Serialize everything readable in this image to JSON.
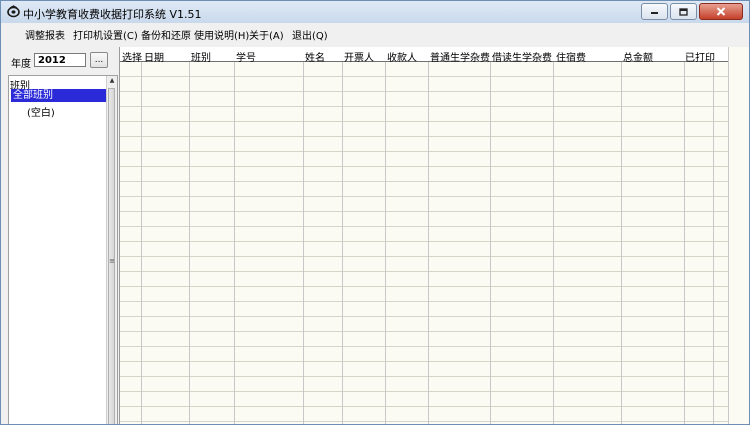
{
  "window": {
    "title": "中小学教育收费收据打印系统 V1.51"
  },
  "menu": [
    {
      "label": "调整报表"
    },
    {
      "label": "打印机设置(C)"
    },
    {
      "label": "备份和还原"
    },
    {
      "label": "使用说明(H)"
    },
    {
      "label": "关于(A)"
    },
    {
      "label": "退出(Q)"
    }
  ],
  "year": {
    "label": "年度",
    "value": "2012",
    "button_label": "..."
  },
  "tree": {
    "header": "班别",
    "items": [
      {
        "label": "全部班别",
        "selected": true
      },
      {
        "label": "(空白)",
        "selected": false
      }
    ]
  },
  "grid": {
    "columns": [
      "选择",
      "日期",
      "班别",
      "学号",
      "姓名",
      "开票人",
      "收款人",
      "普通生学杂费",
      "借读生学杂费",
      "住宿费",
      "总金额",
      "已打印"
    ]
  },
  "colors": {
    "selection": "#2a2ad8",
    "grid_background": "#fbfbf4"
  }
}
